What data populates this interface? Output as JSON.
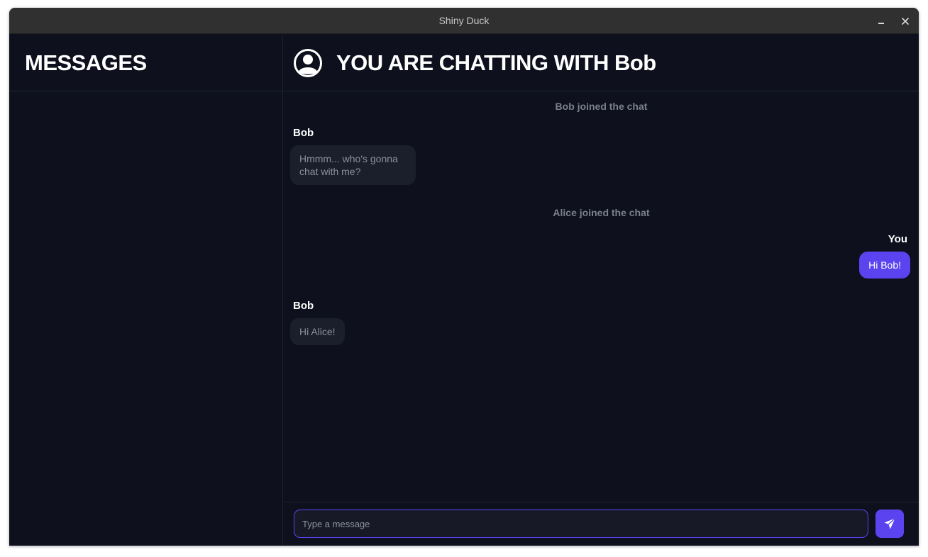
{
  "window": {
    "title": "Shiny Duck"
  },
  "sidebar": {
    "title": "MESSAGES"
  },
  "chat": {
    "header_title": "YOU ARE CHATTING WITH Bob",
    "messages": [
      {
        "type": "system",
        "text": "Bob joined the chat"
      },
      {
        "type": "incoming",
        "sender": "Bob",
        "text_line1": "Hmmm... who's gonna",
        "text_line2": "chat with me?"
      },
      {
        "type": "system",
        "text": "Alice joined the chat"
      },
      {
        "type": "outgoing",
        "sender": "You",
        "text": "Hi Bob!"
      },
      {
        "type": "incoming",
        "sender": "Bob",
        "text": "Hi Alice!"
      }
    ]
  },
  "composer": {
    "placeholder": "Type a message"
  },
  "colors": {
    "accent": "#5b43f0",
    "background": "#0e111d",
    "bubble_in": "#1b1e2b"
  }
}
